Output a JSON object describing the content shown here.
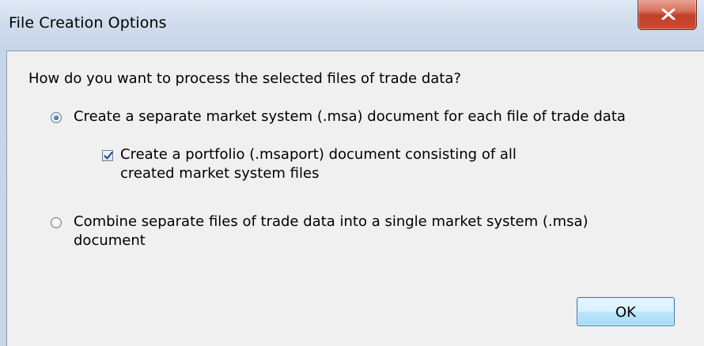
{
  "window": {
    "title": "File Creation Options",
    "close_icon": "close-x-icon"
  },
  "dialog": {
    "question": "How do you want to process the selected files of trade data?",
    "options": [
      {
        "label": "Create a separate market system (.msa) document for each file of trade data",
        "selected": true
      },
      {
        "label": "Combine separate files of trade data into a single market system (.msa) document",
        "selected": false
      }
    ],
    "portfolio_checkbox": {
      "label": "Create a portfolio (.msaport) document consisting of all created market system files",
      "checked": true
    },
    "ok_label": "OK"
  },
  "colors": {
    "client_bg": "#f0f0f0",
    "close_red": "#c1402a",
    "button_border": "#3c7fb1"
  }
}
